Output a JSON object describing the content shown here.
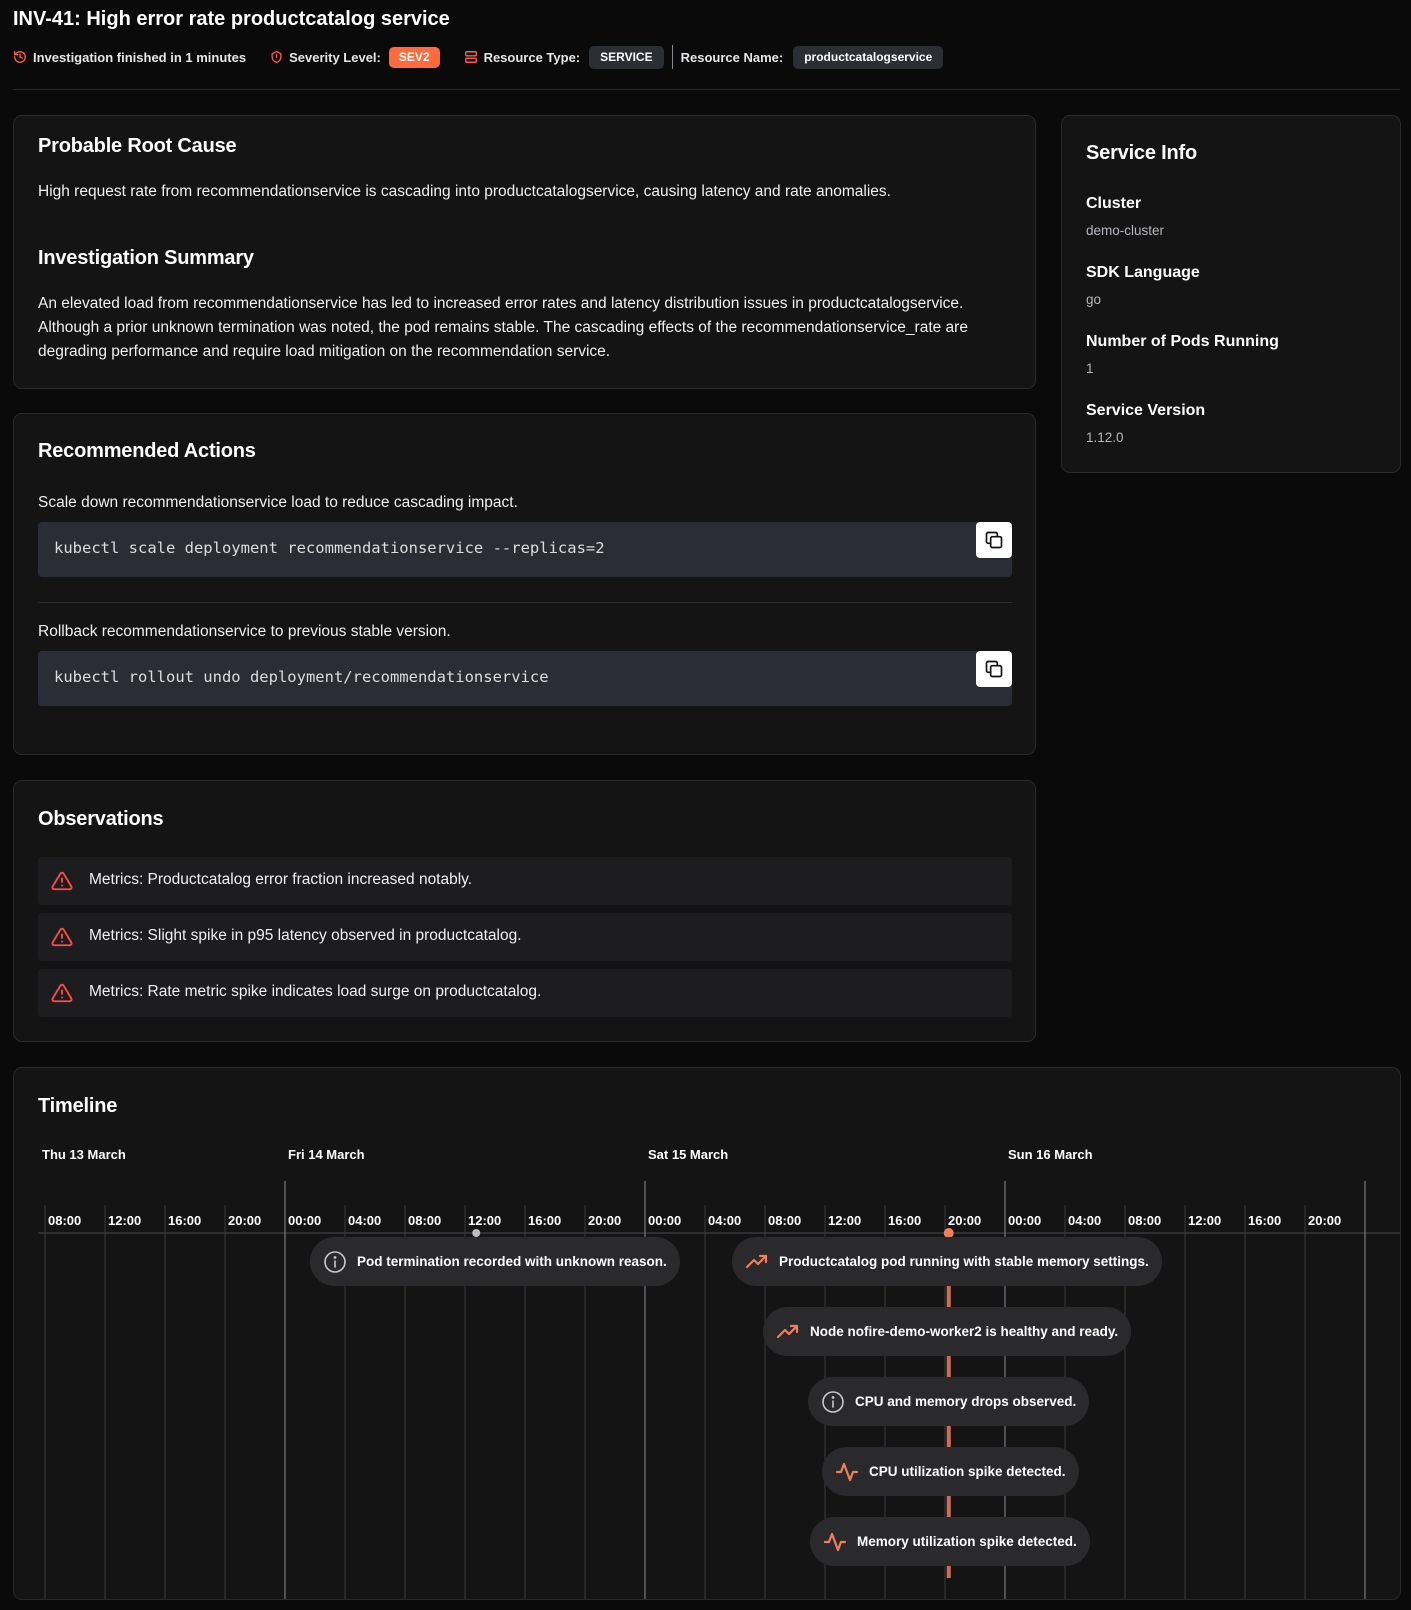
{
  "header": {
    "title": "INV-41: High error rate productcatalog service",
    "investigation_status": "Investigation finished in 1 minutes",
    "severity_label": "Severity Level:",
    "severity_value": "SEV2",
    "resource_type_label": "Resource Type:",
    "resource_type_value": "SERVICE",
    "resource_name_label": "Resource Name:",
    "resource_name_value": "productcatalogservice"
  },
  "root_cause": {
    "title": "Probable Root Cause",
    "text": "High request rate from recommendationservice is cascading into productcatalogservice, causing latency and rate anomalies."
  },
  "summary": {
    "title": "Investigation Summary",
    "text": "An elevated load from recommendationservice has led to increased error rates and latency distribution issues in productcatalogservice. Although a prior unknown termination was noted, the pod remains stable. The cascading effects of the recommendationservice_rate are degrading performance and require load mitigation on the recommendation service."
  },
  "actions": {
    "title": "Recommended Actions",
    "items": [
      {
        "description": "Scale down recommendationservice load to reduce cascading impact.",
        "command": "kubectl scale deployment recommendationservice --replicas=2"
      },
      {
        "description": "Rollback recommendationservice to previous stable version.",
        "command": "kubectl rollout undo deployment/recommendationservice"
      }
    ]
  },
  "observations": {
    "title": "Observations",
    "items": [
      "Metrics: Productcatalog error fraction increased notably.",
      "Metrics: Slight spike in p95 latency observed in productcatalog.",
      "Metrics: Rate metric spike indicates load surge on productcatalog."
    ]
  },
  "service_info": {
    "title": "Service Info",
    "fields": [
      {
        "label": "Cluster",
        "value": "demo-cluster"
      },
      {
        "label": "SDK Language",
        "value": "go"
      },
      {
        "label": "Number of Pods Running",
        "value": "1"
      },
      {
        "label": "Service Version",
        "value": "1.12.0"
      }
    ]
  },
  "timeline": {
    "title": "Timeline",
    "days": [
      "Thu 13 March",
      "Fri 14 March",
      "Sat 15 March",
      "Sun 16 March"
    ],
    "hours": [
      "08:00",
      "12:00",
      "16:00",
      "20:00",
      "00:00",
      "04:00",
      "08:00",
      "12:00",
      "16:00",
      "20:00",
      "00:00",
      "04:00",
      "08:00",
      "12:00",
      "16:00",
      "20:00",
      "00:00",
      "04:00",
      "08:00",
      "12:00",
      "16:00",
      "20:00"
    ],
    "markers": [
      {
        "time": "Fri 14 March 12:45",
        "color": "#bdbdbd"
      },
      {
        "time": "Sat 15 March 20:15",
        "color": "#f07f5a"
      }
    ],
    "events": [
      {
        "text": "Pod termination recorded with unknown reason.",
        "icon": "info-icon"
      },
      {
        "text": "Productcatalog pod running with stable memory settings.",
        "icon": "trending-up-icon"
      },
      {
        "text": "Node nofire-demo-worker2 is healthy and ready.",
        "icon": "trending-up-icon"
      },
      {
        "text": "CPU and memory drops observed.",
        "icon": "info-icon"
      },
      {
        "text": "CPU utilization spike detected.",
        "icon": "activity-icon"
      },
      {
        "text": "Memory utilization spike detected.",
        "icon": "activity-icon"
      }
    ],
    "accent_color": "#f07f5a"
  }
}
